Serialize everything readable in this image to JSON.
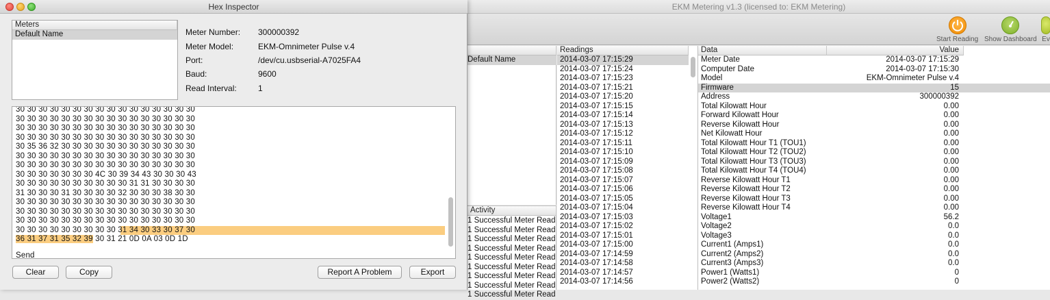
{
  "main_window": {
    "title": "EKM Metering v1.3 (licensed to: EKM Metering)",
    "toolbar": {
      "start_reading": "Start Reading",
      "show_dashboard": "Show Dashboard",
      "events_partial": "Ev"
    },
    "meters_list": {
      "items": [
        "Default Name"
      ]
    },
    "activity": {
      "header": "Activity",
      "items": [
        "1 Successful Meter Read",
        "1 Successful Meter Read",
        "1 Successful Meter Read",
        "1 Successful Meter Read",
        "1 Successful Meter Read",
        "1 Successful Meter Read",
        "1 Successful Meter Read",
        "1 Successful Meter Read",
        "1 Successful Meter Read"
      ]
    },
    "readings": {
      "header": "Readings",
      "items": [
        "2014-03-07 17:15:29",
        "2014-03-07 17:15:24",
        "2014-03-07 17:15:23",
        "2014-03-07 17:15:21",
        "2014-03-07 17:15:20",
        "2014-03-07 17:15:15",
        "2014-03-07 17:15:14",
        "2014-03-07 17:15:13",
        "2014-03-07 17:15:12",
        "2014-03-07 17:15:11",
        "2014-03-07 17:15:10",
        "2014-03-07 17:15:09",
        "2014-03-07 17:15:08",
        "2014-03-07 17:15:07",
        "2014-03-07 17:15:06",
        "2014-03-07 17:15:05",
        "2014-03-07 17:15:04",
        "2014-03-07 17:15:03",
        "2014-03-07 17:15:02",
        "2014-03-07 17:15:01",
        "2014-03-07 17:15:00",
        "2014-03-07 17:14:59",
        "2014-03-07 17:14:58",
        "2014-03-07 17:14:57",
        "2014-03-07 17:14:56"
      ]
    },
    "data_table": {
      "col_data": "Data",
      "col_value": "Value",
      "rows": [
        {
          "name": "Meter Date",
          "value": "2014-03-07 17:15:29"
        },
        {
          "name": "Computer Date",
          "value": "2014-03-07 17:15:30"
        },
        {
          "name": "Model",
          "value": "EKM-Omnimeter Pulse v.4"
        },
        {
          "name": "Firmware",
          "value": "15"
        },
        {
          "name": "Address",
          "value": "300000392"
        },
        {
          "name": "Total Kilowatt Hour",
          "value": "0.00"
        },
        {
          "name": "Forward Kilowatt Hour",
          "value": "0.00"
        },
        {
          "name": "Reverse Kilowatt Hour",
          "value": "0.00"
        },
        {
          "name": "Net Kilowatt Hour",
          "value": "0.00"
        },
        {
          "name": "Total Kilowatt Hour T1 (TOU1)",
          "value": "0.00"
        },
        {
          "name": "Total Kilowatt Hour T2 (TOU2)",
          "value": "0.00"
        },
        {
          "name": "Total Kilowatt Hour T3 (TOU3)",
          "value": "0.00"
        },
        {
          "name": "Total Kilowatt Hour T4 (TOU4)",
          "value": "0.00"
        },
        {
          "name": "Reverse Kilowatt Hour T1",
          "value": "0.00"
        },
        {
          "name": "Reverse Kilowatt Hour T2",
          "value": "0.00"
        },
        {
          "name": "Reverse Kilowatt Hour T3",
          "value": "0.00"
        },
        {
          "name": "Reverse Kilowatt Hour T4",
          "value": "0.00"
        },
        {
          "name": "Voltage1",
          "value": "56.2"
        },
        {
          "name": "Voltage2",
          "value": "0.0"
        },
        {
          "name": "Voltage3",
          "value": "0.0"
        },
        {
          "name": "Current1 (Amps1)",
          "value": "0.0"
        },
        {
          "name": "Current2 (Amps2)",
          "value": "0.0"
        },
        {
          "name": "Current3 (Amps3)",
          "value": "0.0"
        },
        {
          "name": "Power1 (Watts1)",
          "value": "0"
        },
        {
          "name": "Power2 (Watts2)",
          "value": "0"
        }
      ]
    }
  },
  "hex_inspector": {
    "title": "Hex Inspector",
    "meters_header": "Meters",
    "meters_items": [
      "Default Name"
    ],
    "info": {
      "meter_number_label": "Meter Number:",
      "meter_number": "300000392",
      "meter_model_label": "Meter Model:",
      "meter_model": "EKM-Omnimeter Pulse v.4",
      "port_label": "Port:",
      "port": "/dev/cu.usbserial-A7025FA4",
      "baud_label": "Baud:",
      "baud": "9600",
      "read_interval_label": "Read Interval:",
      "read_interval": "1"
    },
    "hex_lines": [
      {
        "plain": "30 30 30 30 30 30 30 30 30 30 30 30 30 30 30 30",
        "hl": ""
      },
      {
        "plain": "30 30 30 30 30 30 30 30 30 30 30 30 30 30 30 30",
        "hl": ""
      },
      {
        "plain": "30 30 30 30 30 30 30 30 30 30 30 30 30 30 30 30",
        "hl": ""
      },
      {
        "plain": "30 30 30 30 30 30 30 30 30 30 30 30 30 30 30 30",
        "hl": ""
      },
      {
        "plain": "30 35 36 32 30 30 30 30 30 30 30 30 30 30 30 30",
        "hl": ""
      },
      {
        "plain": "30 30 30 30 30 30 30 30 30 30 30 30 30 30 30 30",
        "hl": ""
      },
      {
        "plain": "30 30 30 30 30 30 30 30 30 30 30 30 30 30 30 30",
        "hl": ""
      },
      {
        "plain": "30 30 30 30 30 30 30 4C 30 39 34 43 30 30 30 43",
        "hl": ""
      },
      {
        "plain": "30 30 30 30 30 30 30 30 30 30 31 31 30 30 30 30",
        "hl": ""
      },
      {
        "plain": "31 30 30 30 31 30 30 30 30 32 30 30 30 38 30 30",
        "hl": ""
      },
      {
        "plain": "30 30 30 30 30 30 30 30 30 30 30 30 30 30 30 30",
        "hl": ""
      },
      {
        "plain": "30 30 30 30 30 30 30 30 30 30 30 30 30 30 30 30",
        "hl": ""
      },
      {
        "plain": "30 30 30 30 30 30 30 30 30 30 30 30 30 30 30 30",
        "hl": ""
      },
      {
        "plain": "30 30 30 30 30 30 30 30 30 ",
        "hl": "31 34 30 33 30 37 30"
      },
      {
        "pre_hl": "36 31 37 31 35 32 39",
        "plain": " 30 31 21 0D 0A 03 0D 1D",
        "hl": ""
      }
    ],
    "send_label": "Send",
    "buttons": {
      "clear": "Clear",
      "copy": "Copy",
      "report": "Report A Problem",
      "export": "Export"
    },
    "highlight_color": "#fbcd80"
  }
}
